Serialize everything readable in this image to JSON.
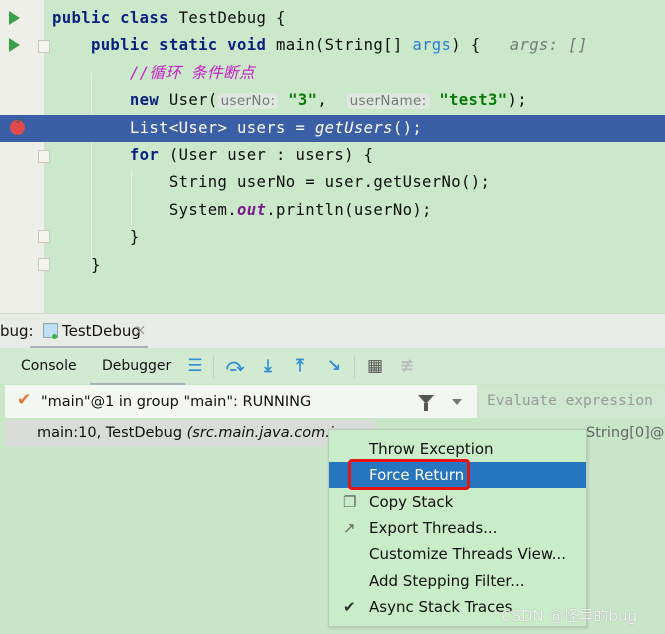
{
  "editor": {
    "lines": [
      [
        {
          "t": "public class ",
          "c": "kw"
        },
        {
          "t": "TestDebug {",
          "c": ""
        }
      ],
      [
        {
          "t": "    public static void ",
          "c": "kw"
        },
        {
          "t": "main(String[] ",
          "c": ""
        },
        {
          "t": "args",
          "c": "param"
        },
        {
          "t": ") {   ",
          "c": ""
        },
        {
          "t": "args: []",
          "c": "hint"
        }
      ],
      [
        {
          "t": "        //循环 条件断点",
          "c": "cm"
        }
      ],
      [
        {
          "t": "        new ",
          "c": "kw"
        },
        {
          "t": "User(",
          "c": ""
        },
        {
          "t": "userNo:",
          "c": "inlay"
        },
        {
          "t": " ",
          "c": ""
        },
        {
          "t": "\"3\"",
          "c": "str"
        },
        {
          "t": ",  ",
          "c": ""
        },
        {
          "t": "userName:",
          "c": "inlay"
        },
        {
          "t": " ",
          "c": ""
        },
        {
          "t": "\"test3\"",
          "c": "str"
        },
        {
          "t": ");",
          "c": ""
        }
      ],
      [
        {
          "t": "        List<User> users = ",
          "c": ""
        },
        {
          "t": "getUsers",
          "c": "ital"
        },
        {
          "t": "();",
          "c": ""
        }
      ],
      [
        {
          "t": "        for ",
          "c": "kw"
        },
        {
          "t": "(User user : users) {",
          "c": ""
        }
      ],
      [
        {
          "t": "            String userNo = user.getUserNo();",
          "c": ""
        }
      ],
      [
        {
          "t": "            System.",
          "c": ""
        },
        {
          "t": "out",
          "c": "fld"
        },
        {
          "t": ".println(userNo);",
          "c": ""
        }
      ],
      [
        {
          "t": "        }",
          "c": ""
        }
      ],
      [
        {
          "t": "    }",
          "c": ""
        }
      ]
    ],
    "highlighted_line": 4
  },
  "debug_panel": {
    "label": "bug:",
    "tab": "TestDebug",
    "tab_close": "×",
    "tabs": [
      "Console",
      "Debugger"
    ],
    "active_tab": "Debugger",
    "thread": "\"main\"@1 in group \"main\": RUNNING",
    "evaluate_placeholder": "Evaluate expression",
    "frame_text": "main:10, TestDebug ",
    "frame_location": "(src.main.java.com.i…",
    "variable_partial": "String[0]@…"
  },
  "context_menu": {
    "items": [
      {
        "label": "Throw Exception",
        "icon": ""
      },
      {
        "label": "Force Return",
        "icon": "",
        "selected": true
      },
      {
        "label": "Copy Stack",
        "icon": "copy-icon"
      },
      {
        "label": "Export Threads...",
        "icon": "export-icon"
      },
      {
        "label": "Customize Threads View...",
        "icon": ""
      },
      {
        "label": "Add Stepping Filter...",
        "icon": ""
      },
      {
        "label": "Async Stack Traces",
        "icon": "check-icon",
        "checked": true
      }
    ]
  },
  "watermark": "CSDN @怪异的bug",
  "colors": {
    "selection": "#2675bf",
    "highlight_line": "#3b5fa6",
    "annotation_box": "#e51515"
  }
}
